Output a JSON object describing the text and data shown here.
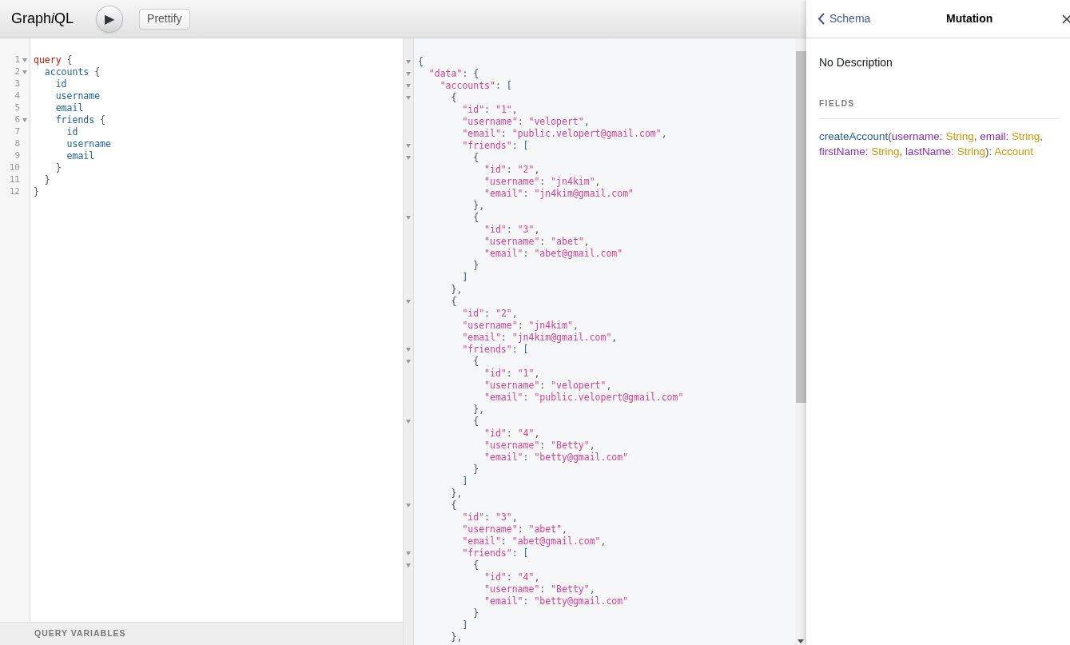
{
  "toolbar": {
    "logo": {
      "before": "Graph",
      "italic": "i",
      "after": "QL"
    },
    "run_button": "▶",
    "prettify_button": "Prettify"
  },
  "query_editor": {
    "lines": [
      {
        "number": "1",
        "fold": true,
        "tokens": [
          {
            "kind": "keyword",
            "text": "query"
          },
          {
            "kind": "punct",
            "text": " {"
          }
        ]
      },
      {
        "number": "2",
        "fold": true,
        "tokens": [
          {
            "kind": "field",
            "text": "  accounts"
          },
          {
            "kind": "punct",
            "text": " {"
          }
        ]
      },
      {
        "number": "3",
        "fold": false,
        "tokens": [
          {
            "kind": "field",
            "text": "    id"
          }
        ]
      },
      {
        "number": "4",
        "fold": false,
        "tokens": [
          {
            "kind": "field",
            "text": "    username"
          }
        ]
      },
      {
        "number": "5",
        "fold": false,
        "tokens": [
          {
            "kind": "field",
            "text": "    email"
          }
        ]
      },
      {
        "number": "6",
        "fold": true,
        "tokens": [
          {
            "kind": "field",
            "text": "    friends"
          },
          {
            "kind": "punct",
            "text": " {"
          }
        ]
      },
      {
        "number": "7",
        "fold": false,
        "tokens": [
          {
            "kind": "field",
            "text": "      id"
          }
        ]
      },
      {
        "number": "8",
        "fold": false,
        "tokens": [
          {
            "kind": "field",
            "text": "      username"
          }
        ]
      },
      {
        "number": "9",
        "fold": false,
        "tokens": [
          {
            "kind": "field",
            "text": "      email"
          }
        ]
      },
      {
        "number": "10",
        "fold": false,
        "tokens": [
          {
            "kind": "punct",
            "text": "    }"
          }
        ]
      },
      {
        "number": "11",
        "fold": false,
        "tokens": [
          {
            "kind": "punct",
            "text": "  }"
          }
        ]
      },
      {
        "number": "12",
        "fold": false,
        "tokens": [
          {
            "kind": "punct",
            "text": "}"
          }
        ]
      }
    ],
    "variables_title": "QUERY VARIABLES"
  },
  "result": {
    "lines": [
      {
        "fold": true,
        "tokens": [
          {
            "kind": "punct",
            "text": "{"
          }
        ]
      },
      {
        "fold": true,
        "tokens": [
          {
            "kind": "key",
            "text": "  \"data\""
          },
          {
            "kind": "punct",
            "text": ": {"
          }
        ]
      },
      {
        "fold": true,
        "tokens": [
          {
            "kind": "key",
            "text": "    \"accounts\""
          },
          {
            "kind": "punct",
            "text": ": "
          },
          {
            "kind": "bracket",
            "text": "["
          }
        ]
      },
      {
        "fold": true,
        "tokens": [
          {
            "kind": "punct",
            "text": "      {"
          }
        ]
      },
      {
        "fold": false,
        "tokens": [
          {
            "kind": "key",
            "text": "        \"id\""
          },
          {
            "kind": "punct",
            "text": ": "
          },
          {
            "kind": "string",
            "text": "\"1\""
          },
          {
            "kind": "punct",
            "text": ","
          }
        ]
      },
      {
        "fold": false,
        "tokens": [
          {
            "kind": "key",
            "text": "        \"username\""
          },
          {
            "kind": "punct",
            "text": ": "
          },
          {
            "kind": "string",
            "text": "\"velopert\""
          },
          {
            "kind": "punct",
            "text": ","
          }
        ]
      },
      {
        "fold": false,
        "tokens": [
          {
            "kind": "key",
            "text": "        \"email\""
          },
          {
            "kind": "punct",
            "text": ": "
          },
          {
            "kind": "string",
            "text": "\"public.velopert@gmail.com\""
          },
          {
            "kind": "punct",
            "text": ","
          }
        ]
      },
      {
        "fold": true,
        "tokens": [
          {
            "kind": "key",
            "text": "        \"friends\""
          },
          {
            "kind": "punct",
            "text": ": "
          },
          {
            "kind": "bracket",
            "text": "["
          }
        ]
      },
      {
        "fold": true,
        "tokens": [
          {
            "kind": "punct",
            "text": "          {"
          }
        ]
      },
      {
        "fold": false,
        "tokens": [
          {
            "kind": "key",
            "text": "            \"id\""
          },
          {
            "kind": "punct",
            "text": ": "
          },
          {
            "kind": "string",
            "text": "\"2\""
          },
          {
            "kind": "punct",
            "text": ","
          }
        ]
      },
      {
        "fold": false,
        "tokens": [
          {
            "kind": "key",
            "text": "            \"username\""
          },
          {
            "kind": "punct",
            "text": ": "
          },
          {
            "kind": "string",
            "text": "\"jn4kim\""
          },
          {
            "kind": "punct",
            "text": ","
          }
        ]
      },
      {
        "fold": false,
        "tokens": [
          {
            "kind": "key",
            "text": "            \"email\""
          },
          {
            "kind": "punct",
            "text": ": "
          },
          {
            "kind": "string",
            "text": "\"jn4kim@gmail.com\""
          }
        ]
      },
      {
        "fold": false,
        "tokens": [
          {
            "kind": "punct",
            "text": "          },"
          }
        ]
      },
      {
        "fold": true,
        "tokens": [
          {
            "kind": "punct",
            "text": "          {"
          }
        ]
      },
      {
        "fold": false,
        "tokens": [
          {
            "kind": "key",
            "text": "            \"id\""
          },
          {
            "kind": "punct",
            "text": ": "
          },
          {
            "kind": "string",
            "text": "\"3\""
          },
          {
            "kind": "punct",
            "text": ","
          }
        ]
      },
      {
        "fold": false,
        "tokens": [
          {
            "kind": "key",
            "text": "            \"username\""
          },
          {
            "kind": "punct",
            "text": ": "
          },
          {
            "kind": "string",
            "text": "\"abet\""
          },
          {
            "kind": "punct",
            "text": ","
          }
        ]
      },
      {
        "fold": false,
        "tokens": [
          {
            "kind": "key",
            "text": "            \"email\""
          },
          {
            "kind": "punct",
            "text": ": "
          },
          {
            "kind": "string",
            "text": "\"abet@gmail.com\""
          }
        ]
      },
      {
        "fold": false,
        "tokens": [
          {
            "kind": "punct",
            "text": "          }"
          }
        ]
      },
      {
        "fold": false,
        "tokens": [
          {
            "kind": "bracket",
            "text": "        ]"
          }
        ]
      },
      {
        "fold": false,
        "tokens": [
          {
            "kind": "punct",
            "text": "      },"
          }
        ]
      },
      {
        "fold": true,
        "tokens": [
          {
            "kind": "punct",
            "text": "      {"
          }
        ]
      },
      {
        "fold": false,
        "tokens": [
          {
            "kind": "key",
            "text": "        \"id\""
          },
          {
            "kind": "punct",
            "text": ": "
          },
          {
            "kind": "string",
            "text": "\"2\""
          },
          {
            "kind": "punct",
            "text": ","
          }
        ]
      },
      {
        "fold": false,
        "tokens": [
          {
            "kind": "key",
            "text": "        \"username\""
          },
          {
            "kind": "punct",
            "text": ": "
          },
          {
            "kind": "string",
            "text": "\"jn4kim\""
          },
          {
            "kind": "punct",
            "text": ","
          }
        ]
      },
      {
        "fold": false,
        "tokens": [
          {
            "kind": "key",
            "text": "        \"email\""
          },
          {
            "kind": "punct",
            "text": ": "
          },
          {
            "kind": "string",
            "text": "\"jn4kim@gmail.com\""
          },
          {
            "kind": "punct",
            "text": ","
          }
        ]
      },
      {
        "fold": true,
        "tokens": [
          {
            "kind": "key",
            "text": "        \"friends\""
          },
          {
            "kind": "punct",
            "text": ": "
          },
          {
            "kind": "bracket",
            "text": "["
          }
        ]
      },
      {
        "fold": true,
        "tokens": [
          {
            "kind": "punct",
            "text": "          {"
          }
        ]
      },
      {
        "fold": false,
        "tokens": [
          {
            "kind": "key",
            "text": "            \"id\""
          },
          {
            "kind": "punct",
            "text": ": "
          },
          {
            "kind": "string",
            "text": "\"1\""
          },
          {
            "kind": "punct",
            "text": ","
          }
        ]
      },
      {
        "fold": false,
        "tokens": [
          {
            "kind": "key",
            "text": "            \"username\""
          },
          {
            "kind": "punct",
            "text": ": "
          },
          {
            "kind": "string",
            "text": "\"velopert\""
          },
          {
            "kind": "punct",
            "text": ","
          }
        ]
      },
      {
        "fold": false,
        "tokens": [
          {
            "kind": "key",
            "text": "            \"email\""
          },
          {
            "kind": "punct",
            "text": ": "
          },
          {
            "kind": "string",
            "text": "\"public.velopert@gmail.com\""
          }
        ]
      },
      {
        "fold": false,
        "tokens": [
          {
            "kind": "punct",
            "text": "          },"
          }
        ]
      },
      {
        "fold": true,
        "tokens": [
          {
            "kind": "punct",
            "text": "          {"
          }
        ]
      },
      {
        "fold": false,
        "tokens": [
          {
            "kind": "key",
            "text": "            \"id\""
          },
          {
            "kind": "punct",
            "text": ": "
          },
          {
            "kind": "string",
            "text": "\"4\""
          },
          {
            "kind": "punct",
            "text": ","
          }
        ]
      },
      {
        "fold": false,
        "tokens": [
          {
            "kind": "key",
            "text": "            \"username\""
          },
          {
            "kind": "punct",
            "text": ": "
          },
          {
            "kind": "string",
            "text": "\"Betty\""
          },
          {
            "kind": "punct",
            "text": ","
          }
        ]
      },
      {
        "fold": false,
        "tokens": [
          {
            "kind": "key",
            "text": "            \"email\""
          },
          {
            "kind": "punct",
            "text": ": "
          },
          {
            "kind": "string",
            "text": "\"betty@gmail.com\""
          }
        ]
      },
      {
        "fold": false,
        "tokens": [
          {
            "kind": "punct",
            "text": "          }"
          }
        ]
      },
      {
        "fold": false,
        "tokens": [
          {
            "kind": "bracket",
            "text": "        ]"
          }
        ]
      },
      {
        "fold": false,
        "tokens": [
          {
            "kind": "punct",
            "text": "      },"
          }
        ]
      },
      {
        "fold": true,
        "tokens": [
          {
            "kind": "punct",
            "text": "      {"
          }
        ]
      },
      {
        "fold": false,
        "tokens": [
          {
            "kind": "key",
            "text": "        \"id\""
          },
          {
            "kind": "punct",
            "text": ": "
          },
          {
            "kind": "string",
            "text": "\"3\""
          },
          {
            "kind": "punct",
            "text": ","
          }
        ]
      },
      {
        "fold": false,
        "tokens": [
          {
            "kind": "key",
            "text": "        \"username\""
          },
          {
            "kind": "punct",
            "text": ": "
          },
          {
            "kind": "string",
            "text": "\"abet\""
          },
          {
            "kind": "punct",
            "text": ","
          }
        ]
      },
      {
        "fold": false,
        "tokens": [
          {
            "kind": "key",
            "text": "        \"email\""
          },
          {
            "kind": "punct",
            "text": ": "
          },
          {
            "kind": "string",
            "text": "\"abet@gmail.com\""
          },
          {
            "kind": "punct",
            "text": ","
          }
        ]
      },
      {
        "fold": true,
        "tokens": [
          {
            "kind": "key",
            "text": "        \"friends\""
          },
          {
            "kind": "punct",
            "text": ": "
          },
          {
            "kind": "bracket",
            "text": "["
          }
        ]
      },
      {
        "fold": true,
        "tokens": [
          {
            "kind": "punct",
            "text": "          {"
          }
        ]
      },
      {
        "fold": false,
        "tokens": [
          {
            "kind": "key",
            "text": "            \"id\""
          },
          {
            "kind": "punct",
            "text": ": "
          },
          {
            "kind": "string",
            "text": "\"4\""
          },
          {
            "kind": "punct",
            "text": ","
          }
        ]
      },
      {
        "fold": false,
        "tokens": [
          {
            "kind": "key",
            "text": "            \"username\""
          },
          {
            "kind": "punct",
            "text": ": "
          },
          {
            "kind": "string",
            "text": "\"Betty\""
          },
          {
            "kind": "punct",
            "text": ","
          }
        ]
      },
      {
        "fold": false,
        "tokens": [
          {
            "kind": "key",
            "text": "            \"email\""
          },
          {
            "kind": "punct",
            "text": ": "
          },
          {
            "kind": "string",
            "text": "\"betty@gmail.com\""
          }
        ]
      },
      {
        "fold": false,
        "tokens": [
          {
            "kind": "punct",
            "text": "          }"
          }
        ]
      },
      {
        "fold": false,
        "tokens": [
          {
            "kind": "bracket",
            "text": "        ]"
          }
        ]
      },
      {
        "fold": false,
        "tokens": [
          {
            "kind": "punct",
            "text": "      },"
          }
        ]
      }
    ]
  },
  "docs": {
    "back_link": "Schema",
    "title": "Mutation",
    "description": "No Description",
    "section_title": "FIELDS",
    "field_signature": [
      {
        "kind": "field",
        "text": "createAccount"
      },
      {
        "kind": "punct",
        "text": "("
      },
      {
        "kind": "arg",
        "text": "username"
      },
      {
        "kind": "punct",
        "text": ": "
      },
      {
        "kind": "type",
        "text": "String"
      },
      {
        "kind": "punct",
        "text": ", "
      },
      {
        "kind": "arg",
        "text": "email"
      },
      {
        "kind": "punct",
        "text": ": "
      },
      {
        "kind": "type",
        "text": "String"
      },
      {
        "kind": "punct",
        "text": ", "
      },
      {
        "kind": "arg",
        "text": "firstName"
      },
      {
        "kind": "punct",
        "text": ": "
      },
      {
        "kind": "type",
        "text": "String"
      },
      {
        "kind": "punct",
        "text": ", "
      },
      {
        "kind": "arg",
        "text": "lastName"
      },
      {
        "kind": "punct",
        "text": ": "
      },
      {
        "kind": "type",
        "text": "String"
      },
      {
        "kind": "punct",
        "text": "): "
      },
      {
        "kind": "type",
        "text": "Account"
      }
    ]
  }
}
